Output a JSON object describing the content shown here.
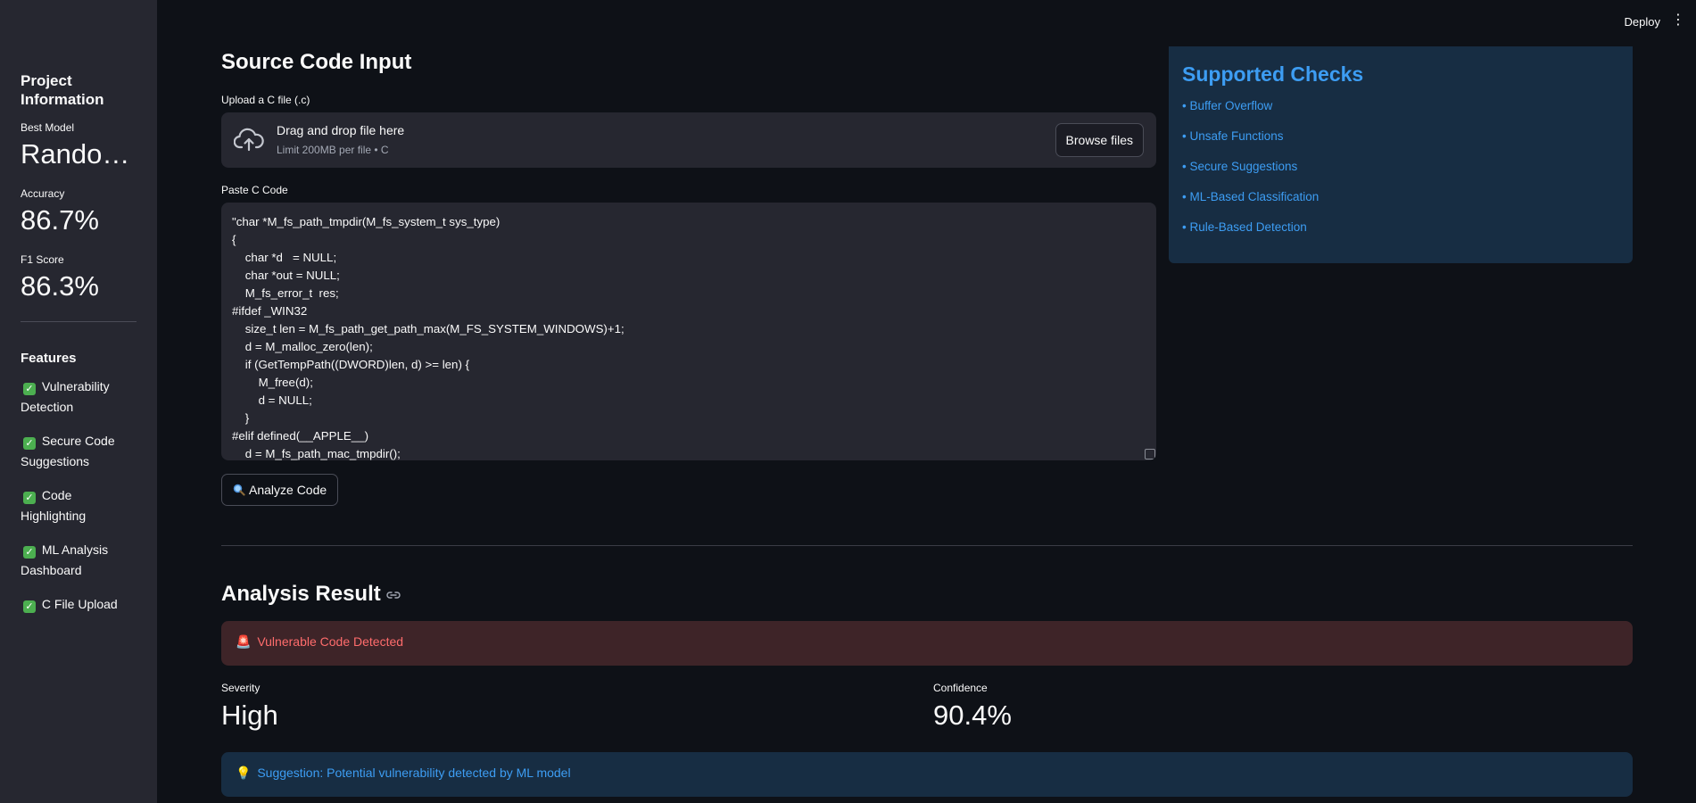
{
  "header": {
    "deploy_label": "Deploy",
    "menu_glyph": "⋮"
  },
  "sidebar": {
    "title": "Project Information",
    "metrics": [
      {
        "label": "Best Model",
        "value": "Random Forest"
      },
      {
        "label": "Accuracy",
        "value": "86.7%"
      },
      {
        "label": "F1 Score",
        "value": "86.3%"
      }
    ],
    "features_title": "Features",
    "features": [
      "Vulnerability Detection",
      "Secure Code Suggestions",
      "Code Highlighting",
      "ML Analysis Dashboard",
      "C File Upload"
    ],
    "check_glyph": "✓"
  },
  "main": {
    "title": "Source Code Input",
    "upload": {
      "label": "Upload a C file (.c)",
      "drag_text": "Drag and drop file here",
      "limit_text": "Limit 200MB per file • C",
      "browse_label": "Browse files",
      "icon": "cloud-upload-icon"
    },
    "paste": {
      "label": "Paste C Code",
      "code": "\"char *M_fs_path_tmpdir(M_fs_system_t sys_type)\n{\n\tchar\t*d   = NULL;\n\tchar\t*out = NULL;\n\tM_fs_error_t  res;\n#ifdef _WIN32\n\tsize_t len = M_fs_path_get_path_max(M_FS_SYSTEM_WINDOWS)+1;\n\td = M_malloc_zero(len);\n\tif (GetTempPath((DWORD)len, d) >= len) {\n\t\tM_free(d);\n\t\td = NULL;\n\t}\n#elif defined(__APPLE__)\n\td = M_fs_path_mac_tmpdir();"
    },
    "analyze_label": "Analyze Code"
  },
  "supported_checks": {
    "title": "Supported Checks",
    "items": [
      "• Buffer Overflow",
      "• Unsafe Functions",
      "• Secure Suggestions",
      "• ML-Based Classification",
      "• Rule-Based Detection"
    ]
  },
  "result": {
    "title": "Analysis Result",
    "alert": "Vulnerable Code Detected",
    "alert_emoji": "🚨",
    "severity_label": "Severity",
    "severity_value": "High",
    "confidence_label": "Confidence",
    "confidence_value": "90.4%",
    "suggestion": "Suggestion: Potential vulnerability detected by ML model",
    "suggestion_emoji": "💡"
  },
  "colors": {
    "background": "#0e1117",
    "sidebar": "#262730",
    "info_blue": "#3d9df3",
    "error_red": "#ff6c6c",
    "success_green": "#4caf50"
  }
}
